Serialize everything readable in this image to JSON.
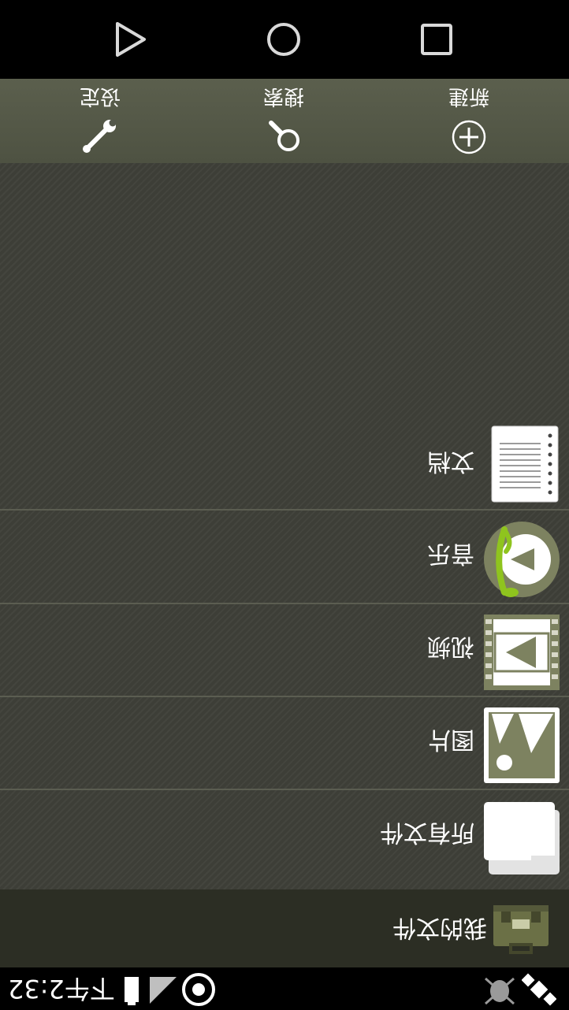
{
  "nav": {
    "back_icon": "triangle-back-icon",
    "home_icon": "circle-home-icon",
    "recents_icon": "square-recents-icon"
  },
  "toolbar": {
    "settings_label": "设定",
    "search_label": "搜索",
    "new_label": "新建"
  },
  "categories": [
    {
      "label": "文档",
      "icon": "document-icon"
    },
    {
      "label": "音乐",
      "icon": "music-icon"
    },
    {
      "label": "视频",
      "icon": "video-icon"
    },
    {
      "label": "图片",
      "icon": "image-icon"
    },
    {
      "label": "所有文件",
      "icon": "folder-icon"
    }
  ],
  "header": {
    "title": "我的文件",
    "icon": "briefcase-icon"
  },
  "status": {
    "time": "下午2:32"
  },
  "colors": {
    "toolbar_bg": "#53574a",
    "content_bg": "#3d3e37",
    "header_bg": "#2c2e24",
    "accent_green": "#8fc41e",
    "icon_olive": "#7d8260"
  }
}
